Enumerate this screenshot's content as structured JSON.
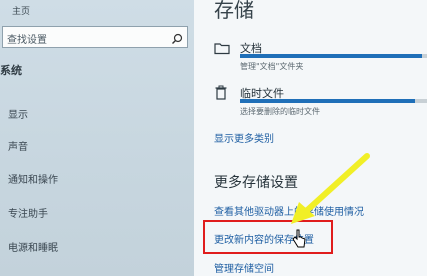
{
  "sidebar": {
    "home_label": "主页",
    "search_placeholder": "查找设置",
    "group_title": "系统",
    "items": [
      {
        "label": "显示",
        "icon": "display-icon"
      },
      {
        "label": "声音",
        "icon": "speaker-icon"
      },
      {
        "label": "通知和操作",
        "icon": "notification-icon"
      },
      {
        "label": "专注助手",
        "icon": "moon-icon"
      },
      {
        "label": "电源和睡眠",
        "icon": "power-icon"
      }
    ]
  },
  "main": {
    "title": "存储",
    "categories": [
      {
        "name": "文档",
        "description": "管理\"文档\"文件夹",
        "icon": "folder-icon",
        "usage_fraction": 0.96
      },
      {
        "name": "临时文件",
        "description": "选择要删除的临时文件",
        "icon": "trash-icon",
        "usage_fraction": 0.92
      }
    ],
    "show_more_link": "显示更多类别",
    "more_settings_title": "更多存储设置",
    "links": [
      "查看其他驱动器上的存储使用情况",
      "更改新内容的保存位置",
      "管理存储空间"
    ]
  },
  "annotation": {
    "highlight_color": "#e01d1d",
    "arrow_color": "#f1ef27"
  }
}
